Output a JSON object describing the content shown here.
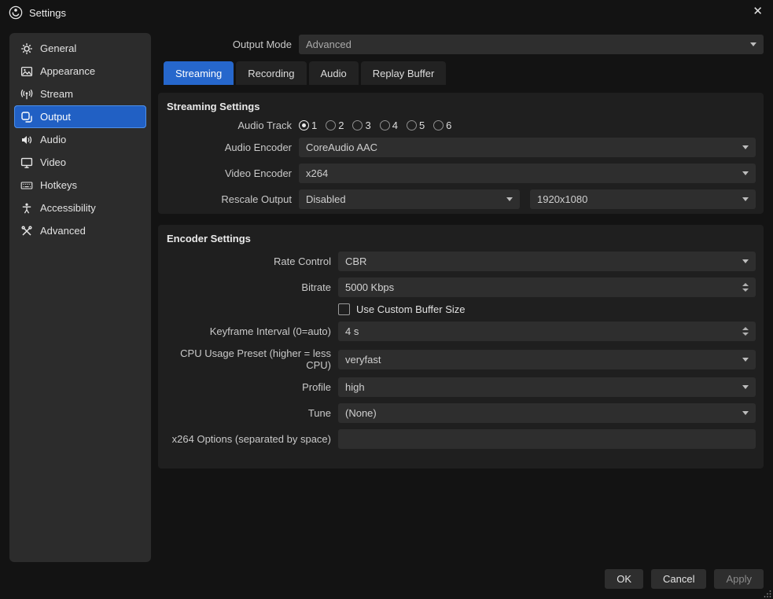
{
  "colors": {
    "accent_blue": "#2667cc",
    "selection_border": "#4d8fe8",
    "panel_bg": "#1f1f1f",
    "sidebar_bg": "#2c2c2c"
  },
  "titlebar": {
    "title": "Settings",
    "close_glyph": "✕"
  },
  "sidebar": {
    "items": [
      {
        "label": "General"
      },
      {
        "label": "Appearance"
      },
      {
        "label": "Stream"
      },
      {
        "label": "Output",
        "selected": true
      },
      {
        "label": "Audio"
      },
      {
        "label": "Video"
      },
      {
        "label": "Hotkeys"
      },
      {
        "label": "Accessibility"
      },
      {
        "label": "Advanced"
      }
    ]
  },
  "output_mode": {
    "label": "Output Mode",
    "value": "Advanced"
  },
  "tabs": [
    {
      "label": "Streaming",
      "active": true
    },
    {
      "label": "Recording",
      "active": false
    },
    {
      "label": "Audio",
      "active": false
    },
    {
      "label": "Replay Buffer",
      "active": false
    }
  ],
  "streaming": {
    "title": "Streaming Settings",
    "audio_track": {
      "label": "Audio Track",
      "options": [
        "1",
        "2",
        "3",
        "4",
        "5",
        "6"
      ],
      "selected": "1"
    },
    "audio_encoder": {
      "label": "Audio Encoder",
      "value": "CoreAudio AAC"
    },
    "video_encoder": {
      "label": "Video Encoder",
      "value": "x264"
    },
    "rescale_output": {
      "label": "Rescale Output",
      "mode": "Disabled",
      "resolution": "1920x1080"
    }
  },
  "encoder": {
    "title": "Encoder Settings",
    "rate_control": {
      "label": "Rate Control",
      "value": "CBR"
    },
    "bitrate": {
      "label": "Bitrate",
      "value": "5000 Kbps"
    },
    "custom_buffer": {
      "label": "Use Custom Buffer Size",
      "checked": false
    },
    "keyframe_interval": {
      "label": "Keyframe Interval (0=auto)",
      "value": "4 s"
    },
    "cpu_preset": {
      "label": "CPU Usage Preset (higher = less CPU)",
      "value": "veryfast"
    },
    "profile": {
      "label": "Profile",
      "value": "high"
    },
    "tune": {
      "label": "Tune",
      "value": "(None)"
    },
    "x264_options": {
      "label": "x264 Options (separated by space)",
      "value": ""
    }
  },
  "footer": {
    "ok": "OK",
    "cancel": "Cancel",
    "apply": "Apply"
  }
}
